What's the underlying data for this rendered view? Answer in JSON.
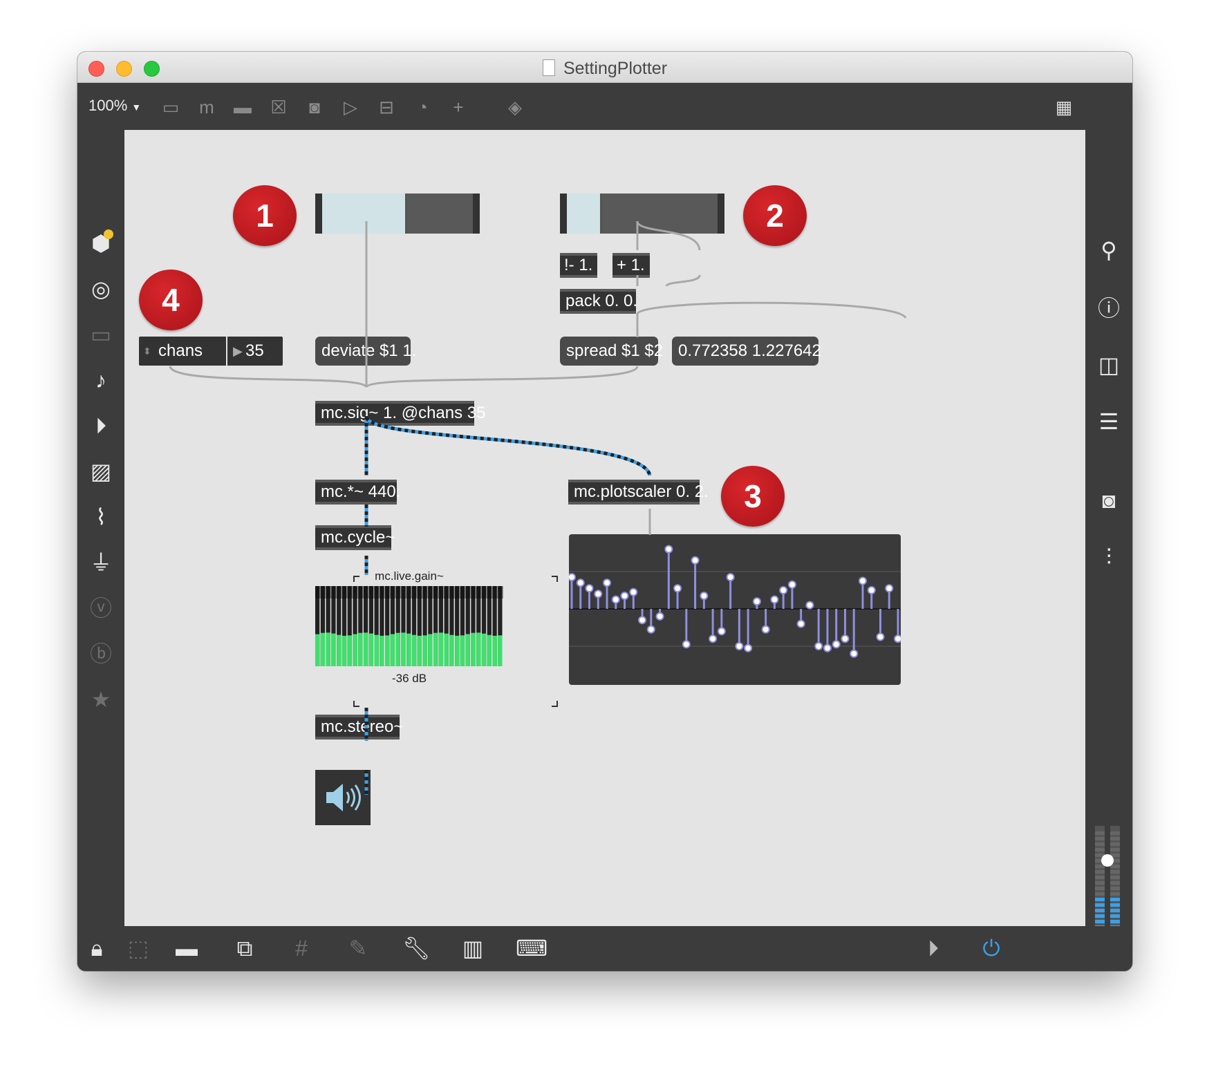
{
  "window": {
    "title": "SettingPlotter"
  },
  "toolbar": {
    "zoom": "100%",
    "icons": [
      "new-object-icon",
      "new-message-icon",
      "comment-icon",
      "button-icon",
      "toggle-icon",
      "number-icon",
      "slider-icon",
      "dial-icon",
      "plus-icon",
      "paint-bucket-icon",
      "grid-icon"
    ]
  },
  "left_sidebar": {
    "icons": [
      "package-icon",
      "target-icon",
      "presentation-icon",
      "music-note-icon",
      "media-icon",
      "image-icon",
      "paperclip-icon",
      "plug-icon",
      "v-icon",
      "b-icon",
      "star-icon"
    ]
  },
  "right_sidebar": {
    "icons": [
      "search-icon",
      "info-icon",
      "columns-icon",
      "list-icon",
      "camera-icon",
      "mixer-icon"
    ],
    "level_meter": {
      "value": 0.75
    }
  },
  "bottom_bar": {
    "icons": [
      "lock-icon",
      "select-icon",
      "presentation-mode-icon",
      "window-stack-icon",
      "grid-toggle-icon",
      "pin-icon",
      "wrench-icon",
      "piano-icon",
      "keyboard-icon",
      "play-icon",
      "power-icon"
    ]
  },
  "badges": [
    "1",
    "2",
    "3",
    "4"
  ],
  "patch": {
    "slider1": {
      "value": 0.55
    },
    "slider2": {
      "value": 0.22
    },
    "op_rminus": "!- 1.",
    "op_plus": "+ 1.",
    "pack": "pack 0. 0.",
    "chans_label": "chans",
    "chans_value": "35",
    "deviate": "deviate $1 1.",
    "spread": "spread $1 $2",
    "spread_result": "0.772358 1.227642",
    "mc_sig": "mc.sig~ 1. @chans 35",
    "mc_mult": "mc.*~ 440.",
    "mc_cycle": "mc.cycle~",
    "mc_live_gain_label": "mc.live.gain~",
    "mc_live_gain_value": "-36 dB",
    "mc_stereo": "mc.stereo~",
    "mc_plotscaler": "mc.plotscaler 0. 2.",
    "ezdac_icon": "speaker-icon"
  },
  "plot": {
    "values": [
      0.85,
      0.7,
      0.55,
      0.4,
      0.7,
      0.25,
      0.35,
      0.45,
      -0.3,
      -0.55,
      -0.2,
      1.6,
      0.55,
      -0.95,
      1.3,
      0.35,
      -0.8,
      -0.6,
      0.85,
      -1.0,
      -1.05,
      0.2,
      -0.55,
      0.25,
      0.5,
      0.65,
      -0.4,
      0.1,
      -1.0,
      -1.05,
      -0.95,
      -0.8,
      -1.2,
      0.75,
      0.5,
      -0.75,
      0.55,
      -0.8
    ]
  },
  "colors": {
    "accent_blue": "#3ba0e8",
    "plot_stem": "#8f8fe0",
    "badge_red": "#c4161c",
    "meter_green": "#3fe06b"
  }
}
